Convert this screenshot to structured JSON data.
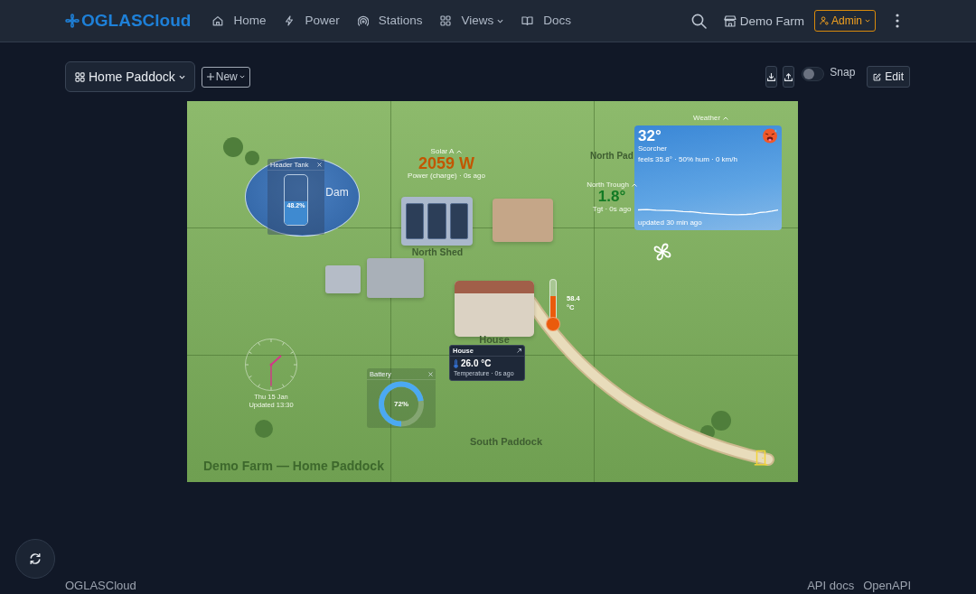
{
  "nav": {
    "brand": "OGLASCloud",
    "items": [
      {
        "label": "Home",
        "selected": false,
        "dropdown": false
      },
      {
        "label": "Power",
        "selected": false,
        "dropdown": false
      },
      {
        "label": "Stations",
        "selected": false,
        "dropdown": false
      },
      {
        "label": "Views",
        "selected": false,
        "dropdown": true
      },
      {
        "label": "Docs",
        "selected": false,
        "dropdown": false
      }
    ],
    "farm": "Demo Farm",
    "user": "Admin"
  },
  "toolbar": {
    "view": "Home Paddock",
    "new_button": "New",
    "snap": {
      "label": "Snap",
      "on": false
    },
    "edit_button": "Edit"
  },
  "map": {
    "paddocks": [
      "North Pad",
      "South Paddock"
    ],
    "dam": "Dam",
    "shed": "North Shed",
    "house": "House",
    "caption": "Demo Farm — Home Paddock",
    "tank": {
      "title": "Header Tank",
      "level": 0.482,
      "reading": "48.2%"
    },
    "power": {
      "title": "Solar A",
      "value": "2059 W",
      "caption": "Power (charge) · 0s ago"
    },
    "trough": {
      "title": "North Trough",
      "value": "1.8°",
      "caption": "Tgt · 0s ago"
    },
    "weather": {
      "title": "Weather",
      "temperature": "32°",
      "condition": "Scorcher",
      "details": "feels 35.8° · 50% hum · 0 km/h",
      "updated": "updated 30 min ago"
    },
    "thermometer": {
      "level": 0.6,
      "reading": "58.4",
      "unit": "°C"
    },
    "house_sensor": {
      "title": "House",
      "value": "26.0 °C",
      "caption": "Temperature · 0s ago"
    },
    "clock": {
      "date": "Thu 15 Jan",
      "updated": "Updated 13:30"
    },
    "battery": {
      "title": "Battery",
      "level": 0.72,
      "reading": "72%"
    }
  },
  "footer": {
    "brand": "OGLASCloud",
    "links": [
      "API docs",
      "OpenAPI"
    ]
  }
}
